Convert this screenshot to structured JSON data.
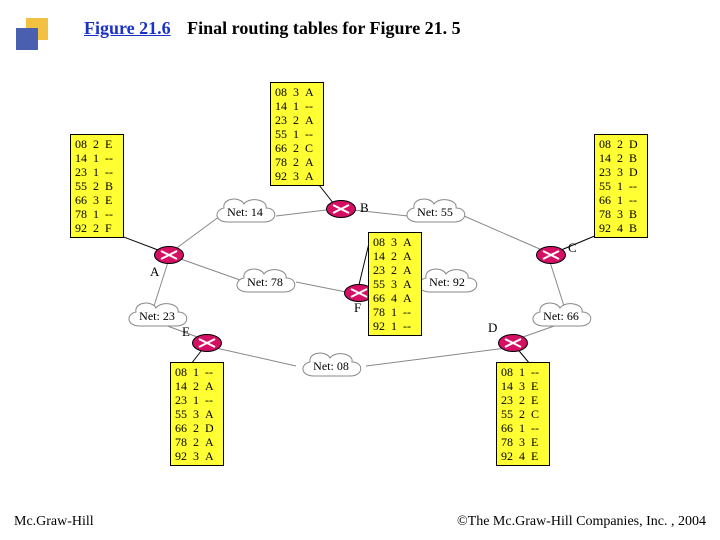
{
  "header": {
    "figure_number": "Figure 21.6",
    "caption": "Final routing tables for Figure 21. 5"
  },
  "footer": {
    "left": "Mc.Graw-Hill",
    "right": "©The Mc.Graw-Hill Companies, Inc. , 2004"
  },
  "routers": [
    "A",
    "B",
    "C",
    "D",
    "E",
    "F"
  ],
  "networks": [
    "Net: 14",
    "Net: 55",
    "Net: 78",
    "Net: 92",
    "Net: 23",
    "Net: 66",
    "Net: 08"
  ],
  "routing_tables": {
    "A": [
      {
        "net": "08",
        "hops": "2",
        "next": "E"
      },
      {
        "net": "14",
        "hops": "1",
        "next": "--"
      },
      {
        "net": "23",
        "hops": "1",
        "next": "--"
      },
      {
        "net": "55",
        "hops": "2",
        "next": "B"
      },
      {
        "net": "66",
        "hops": "3",
        "next": "E"
      },
      {
        "net": "78",
        "hops": "1",
        "next": "--"
      },
      {
        "net": "92",
        "hops": "2",
        "next": "F"
      }
    ],
    "B": [
      {
        "net": "08",
        "hops": "3",
        "next": "A"
      },
      {
        "net": "14",
        "hops": "1",
        "next": "--"
      },
      {
        "net": "23",
        "hops": "2",
        "next": "A"
      },
      {
        "net": "55",
        "hops": "1",
        "next": "--"
      },
      {
        "net": "66",
        "hops": "2",
        "next": "C"
      },
      {
        "net": "78",
        "hops": "2",
        "next": "A"
      },
      {
        "net": "92",
        "hops": "3",
        "next": "A"
      }
    ],
    "C": [
      {
        "net": "08",
        "hops": "2",
        "next": "D"
      },
      {
        "net": "14",
        "hops": "2",
        "next": "B"
      },
      {
        "net": "23",
        "hops": "3",
        "next": "D"
      },
      {
        "net": "55",
        "hops": "1",
        "next": "--"
      },
      {
        "net": "66",
        "hops": "1",
        "next": "--"
      },
      {
        "net": "78",
        "hops": "3",
        "next": "B"
      },
      {
        "net": "92",
        "hops": "4",
        "next": "B"
      }
    ],
    "D": [
      {
        "net": "08",
        "hops": "1",
        "next": "--"
      },
      {
        "net": "14",
        "hops": "3",
        "next": "E"
      },
      {
        "net": "23",
        "hops": "2",
        "next": "E"
      },
      {
        "net": "55",
        "hops": "2",
        "next": "C"
      },
      {
        "net": "66",
        "hops": "1",
        "next": "--"
      },
      {
        "net": "78",
        "hops": "3",
        "next": "E"
      },
      {
        "net": "92",
        "hops": "4",
        "next": "E"
      }
    ],
    "E": [
      {
        "net": "08",
        "hops": "1",
        "next": "--"
      },
      {
        "net": "14",
        "hops": "2",
        "next": "A"
      },
      {
        "net": "23",
        "hops": "1",
        "next": "--"
      },
      {
        "net": "55",
        "hops": "3",
        "next": "A"
      },
      {
        "net": "66",
        "hops": "2",
        "next": "D"
      },
      {
        "net": "78",
        "hops": "2",
        "next": "A"
      },
      {
        "net": "92",
        "hops": "3",
        "next": "A"
      }
    ],
    "F": [
      {
        "net": "08",
        "hops": "3",
        "next": "A"
      },
      {
        "net": "14",
        "hops": "2",
        "next": "A"
      },
      {
        "net": "23",
        "hops": "2",
        "next": "A"
      },
      {
        "net": "55",
        "hops": "3",
        "next": "A"
      },
      {
        "net": "66",
        "hops": "4",
        "next": "A"
      },
      {
        "net": "78",
        "hops": "1",
        "next": "--"
      },
      {
        "net": "92",
        "hops": "1",
        "next": "--"
      }
    ]
  }
}
